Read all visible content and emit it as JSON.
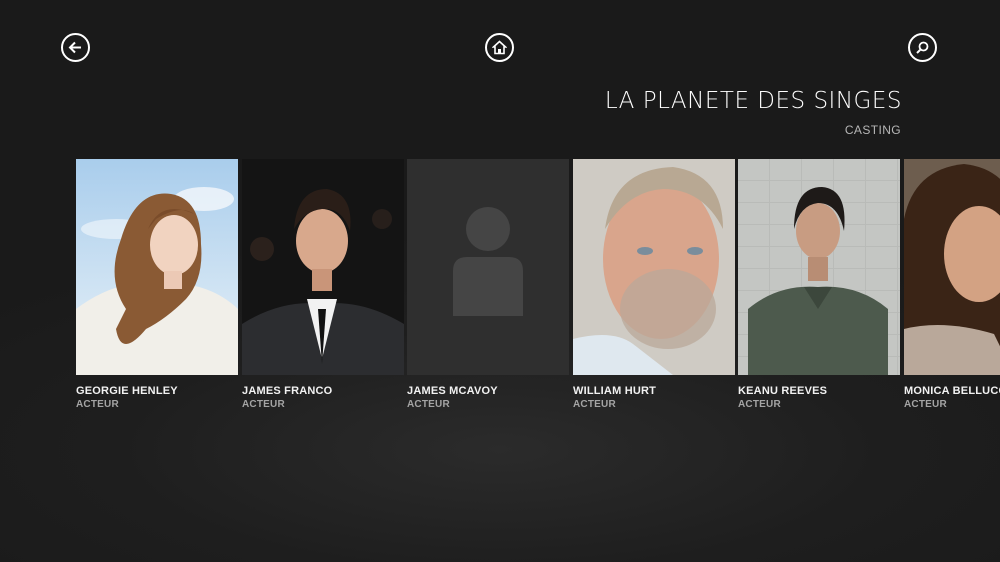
{
  "nav": {
    "back_icon": "back-arrow-icon",
    "home_icon": "home-icon",
    "search_icon": "search-icon"
  },
  "header": {
    "title": "LA PLANETE DES SINGES",
    "subtitle": "CASTING"
  },
  "cast": [
    {
      "name": "GEORGIE HENLEY",
      "role": "ACTEUR",
      "photo": "portrait"
    },
    {
      "name": "JAMES FRANCO",
      "role": "ACTEUR",
      "photo": "portrait"
    },
    {
      "name": "JAMES MCAVOY",
      "role": "ACTEUR",
      "photo": "placeholder"
    },
    {
      "name": "WILLIAM HURT",
      "role": "ACTEUR",
      "photo": "portrait"
    },
    {
      "name": "KEANU REEVES",
      "role": "ACTEUR",
      "photo": "portrait"
    },
    {
      "name": "MONICA BELLUCC",
      "role": "ACTEUR",
      "photo": "portrait"
    }
  ],
  "colors": {
    "background": "#1e1e1e",
    "placeholder_tile": "#2f2f2f",
    "placeholder_figure": "#454545"
  }
}
